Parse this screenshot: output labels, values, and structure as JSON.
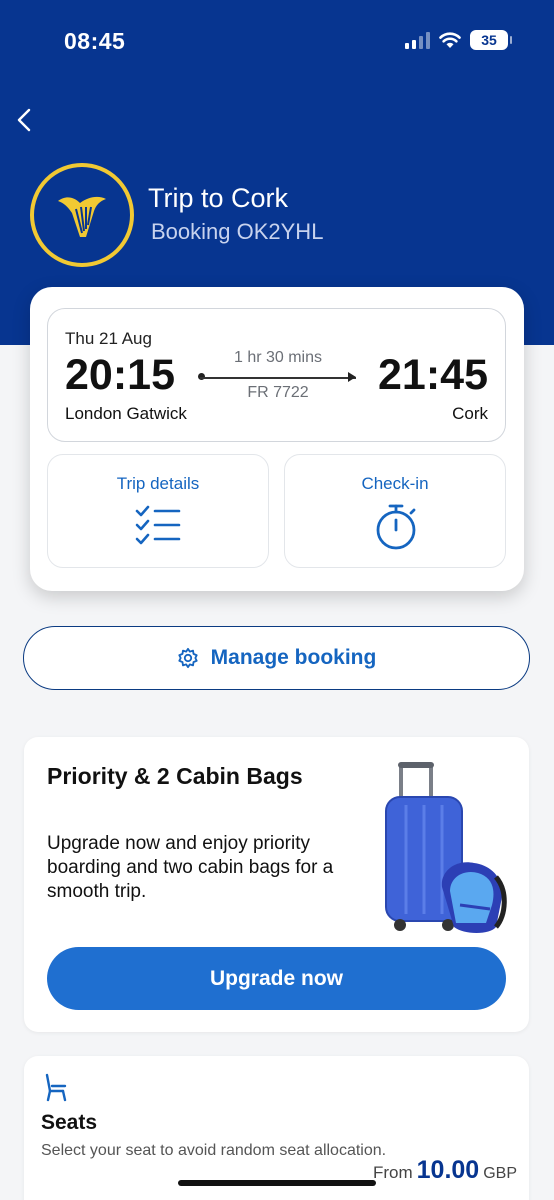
{
  "status_bar": {
    "time": "08:45",
    "battery": "35"
  },
  "header": {
    "trip_title": "Trip to Cork",
    "booking_ref": "Booking OK2YHL"
  },
  "flight": {
    "date": "Thu 21 Aug",
    "departure_time": "20:15",
    "arrival_time": "21:45",
    "origin": "London Gatwick",
    "destination": "Cork",
    "duration": "1 hr 30 mins",
    "flight_number": "FR 7722"
  },
  "actions": {
    "trip_details": "Trip details",
    "check_in": "Check-in"
  },
  "manage": {
    "label": "Manage booking"
  },
  "promo": {
    "title": "Priority & 2 Cabin Bags",
    "body": "Upgrade now and enjoy priority boarding and two cabin bags for a smooth trip.",
    "button": "Upgrade now"
  },
  "seats": {
    "title": "Seats",
    "subtitle": "Select your seat to avoid random seat allocation.",
    "price_prefix": "From",
    "price_amount": "10.00",
    "price_currency": "GBP"
  },
  "colors": {
    "brand_blue": "#073590",
    "accent_blue": "#1f6fd0",
    "logo_gold": "#f1c933"
  }
}
